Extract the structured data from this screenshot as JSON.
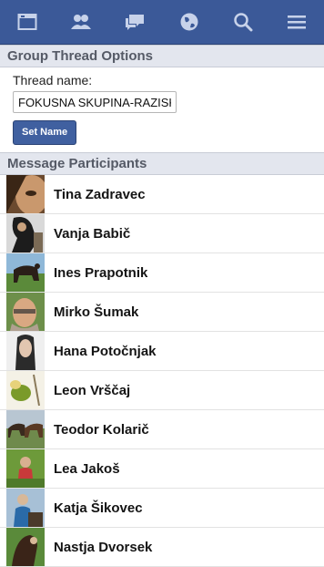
{
  "topbar": {
    "icons": [
      "inbox-icon",
      "friends-icon",
      "messages-icon",
      "globe-icon",
      "search-icon",
      "menu-icon"
    ]
  },
  "thread_options": {
    "header": "Group Thread Options",
    "thread_label": "Thread name:",
    "thread_value": "FOKUSNA SKUPINA-RAZISK",
    "set_name_label": "Set Name"
  },
  "participants": {
    "header": "Message Participants",
    "items": [
      {
        "name": "Tina Zadravec"
      },
      {
        "name": "Vanja Babič"
      },
      {
        "name": "Ines Prapotnik"
      },
      {
        "name": "Mirko Šumak"
      },
      {
        "name": "Hana Potočnjak"
      },
      {
        "name": "Leon Vrščaj"
      },
      {
        "name": "Teodor Kolarič"
      },
      {
        "name": "Lea Jakoš"
      },
      {
        "name": "Katja Šikovec"
      },
      {
        "name": "Nastja Dvorsek"
      }
    ]
  },
  "colors": {
    "topbar": "#3b5998",
    "section_header": "#e3e6ee",
    "button": "#4060a0"
  }
}
